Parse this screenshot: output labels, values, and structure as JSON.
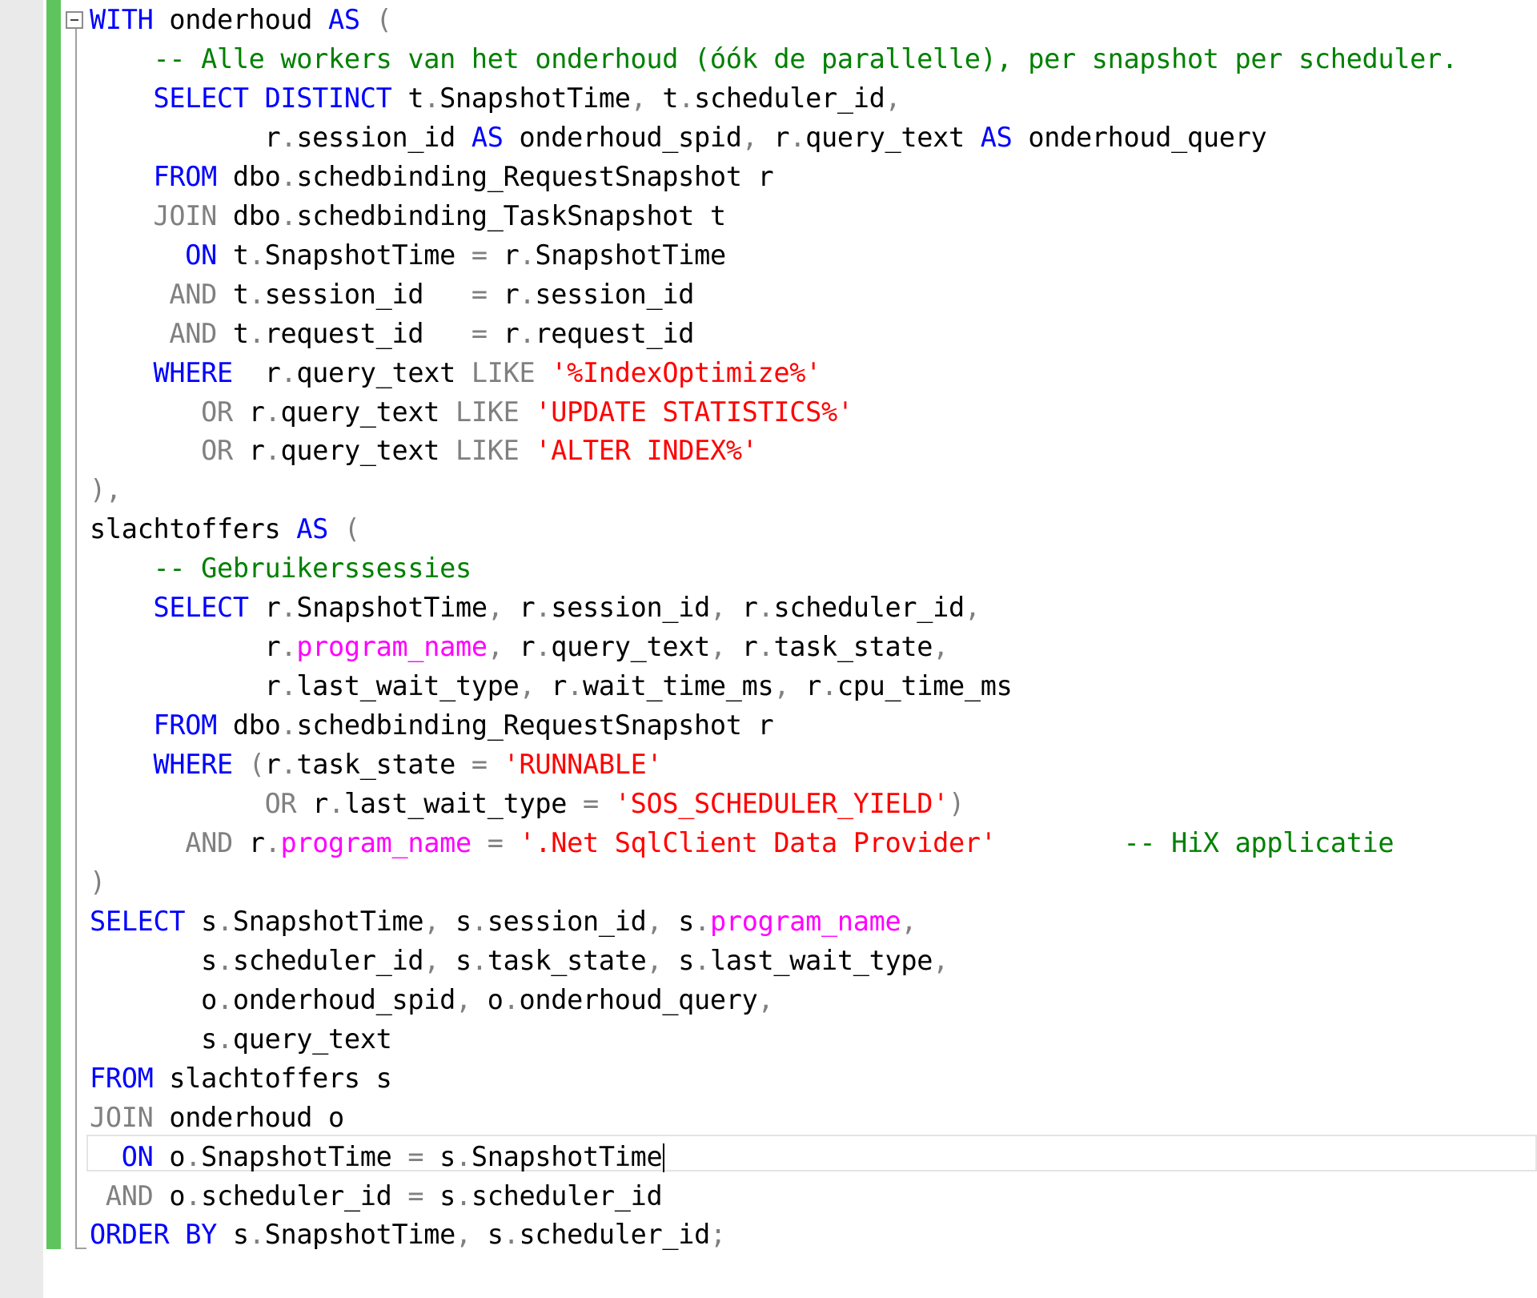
{
  "editor": {
    "colors": {
      "background": "#ffffff",
      "gutter": "#eaeaea",
      "change_bar": "#5ec55e",
      "keyword": "#0000ff",
      "operator": "#808080",
      "string": "#ff0000",
      "comment": "#008000",
      "function": "#ff00ff",
      "identifier": "#000000"
    },
    "fold_icon": "collapse-minus-icon",
    "caret_line": 29,
    "lines": [
      [
        {
          "t": "WITH",
          "k": "kw"
        },
        {
          "t": " onderhoud ",
          "k": "id"
        },
        {
          "t": "AS",
          "k": "kw"
        },
        {
          "t": " (",
          "k": "op"
        }
      ],
      [
        {
          "t": "    -- Alle workers van het onderhoud (óók de parallelle), per snapshot per scheduler.",
          "k": "cm"
        }
      ],
      [
        {
          "t": "    ",
          "k": "id"
        },
        {
          "t": "SELECT DISTINCT",
          "k": "kw"
        },
        {
          "t": " t",
          "k": "id"
        },
        {
          "t": ".",
          "k": "op"
        },
        {
          "t": "SnapshotTime",
          "k": "id"
        },
        {
          "t": ",",
          "k": "op"
        },
        {
          "t": " t",
          "k": "id"
        },
        {
          "t": ".",
          "k": "op"
        },
        {
          "t": "scheduler_id",
          "k": "id"
        },
        {
          "t": ",",
          "k": "op"
        }
      ],
      [
        {
          "t": "           r",
          "k": "id"
        },
        {
          "t": ".",
          "k": "op"
        },
        {
          "t": "session_id ",
          "k": "id"
        },
        {
          "t": "AS",
          "k": "kw"
        },
        {
          "t": " onderhoud_spid",
          "k": "id"
        },
        {
          "t": ",",
          "k": "op"
        },
        {
          "t": " r",
          "k": "id"
        },
        {
          "t": ".",
          "k": "op"
        },
        {
          "t": "query_text ",
          "k": "id"
        },
        {
          "t": "AS",
          "k": "kw"
        },
        {
          "t": " onderhoud_query",
          "k": "id"
        }
      ],
      [
        {
          "t": "    ",
          "k": "id"
        },
        {
          "t": "FROM",
          "k": "kw"
        },
        {
          "t": " dbo",
          "k": "id"
        },
        {
          "t": ".",
          "k": "op"
        },
        {
          "t": "schedbinding_RequestSnapshot r",
          "k": "id"
        }
      ],
      [
        {
          "t": "    ",
          "k": "id"
        },
        {
          "t": "JOIN",
          "k": "op"
        },
        {
          "t": " dbo",
          "k": "id"
        },
        {
          "t": ".",
          "k": "op"
        },
        {
          "t": "schedbinding_TaskSnapshot t",
          "k": "id"
        }
      ],
      [
        {
          "t": "      ",
          "k": "id"
        },
        {
          "t": "ON",
          "k": "kw"
        },
        {
          "t": " t",
          "k": "id"
        },
        {
          "t": ".",
          "k": "op"
        },
        {
          "t": "SnapshotTime ",
          "k": "id"
        },
        {
          "t": "=",
          "k": "op"
        },
        {
          "t": " r",
          "k": "id"
        },
        {
          "t": ".",
          "k": "op"
        },
        {
          "t": "SnapshotTime",
          "k": "id"
        }
      ],
      [
        {
          "t": "     ",
          "k": "id"
        },
        {
          "t": "AND",
          "k": "op"
        },
        {
          "t": " t",
          "k": "id"
        },
        {
          "t": ".",
          "k": "op"
        },
        {
          "t": "session_id   ",
          "k": "id"
        },
        {
          "t": "=",
          "k": "op"
        },
        {
          "t": " r",
          "k": "id"
        },
        {
          "t": ".",
          "k": "op"
        },
        {
          "t": "session_id",
          "k": "id"
        }
      ],
      [
        {
          "t": "     ",
          "k": "id"
        },
        {
          "t": "AND",
          "k": "op"
        },
        {
          "t": " t",
          "k": "id"
        },
        {
          "t": ".",
          "k": "op"
        },
        {
          "t": "request_id   ",
          "k": "id"
        },
        {
          "t": "=",
          "k": "op"
        },
        {
          "t": " r",
          "k": "id"
        },
        {
          "t": ".",
          "k": "op"
        },
        {
          "t": "request_id",
          "k": "id"
        }
      ],
      [
        {
          "t": "    ",
          "k": "id"
        },
        {
          "t": "WHERE",
          "k": "kw"
        },
        {
          "t": "  r",
          "k": "id"
        },
        {
          "t": ".",
          "k": "op"
        },
        {
          "t": "query_text ",
          "k": "id"
        },
        {
          "t": "LIKE",
          "k": "op"
        },
        {
          "t": " ",
          "k": "id"
        },
        {
          "t": "'%IndexOptimize%'",
          "k": "str"
        }
      ],
      [
        {
          "t": "       ",
          "k": "id"
        },
        {
          "t": "OR",
          "k": "op"
        },
        {
          "t": " r",
          "k": "id"
        },
        {
          "t": ".",
          "k": "op"
        },
        {
          "t": "query_text ",
          "k": "id"
        },
        {
          "t": "LIKE",
          "k": "op"
        },
        {
          "t": " ",
          "k": "id"
        },
        {
          "t": "'UPDATE STATISTICS%'",
          "k": "str"
        }
      ],
      [
        {
          "t": "       ",
          "k": "id"
        },
        {
          "t": "OR",
          "k": "op"
        },
        {
          "t": " r",
          "k": "id"
        },
        {
          "t": ".",
          "k": "op"
        },
        {
          "t": "query_text ",
          "k": "id"
        },
        {
          "t": "LIKE",
          "k": "op"
        },
        {
          "t": " ",
          "k": "id"
        },
        {
          "t": "'ALTER INDEX%'",
          "k": "str"
        }
      ],
      [
        {
          "t": "),",
          "k": "op"
        }
      ],
      [
        {
          "t": "slachtoffers ",
          "k": "id"
        },
        {
          "t": "AS",
          "k": "kw"
        },
        {
          "t": " (",
          "k": "op"
        }
      ],
      [
        {
          "t": "    -- Gebruikerssessies",
          "k": "cm"
        }
      ],
      [
        {
          "t": "    ",
          "k": "id"
        },
        {
          "t": "SELECT",
          "k": "kw"
        },
        {
          "t": " r",
          "k": "id"
        },
        {
          "t": ".",
          "k": "op"
        },
        {
          "t": "SnapshotTime",
          "k": "id"
        },
        {
          "t": ",",
          "k": "op"
        },
        {
          "t": " r",
          "k": "id"
        },
        {
          "t": ".",
          "k": "op"
        },
        {
          "t": "session_id",
          "k": "id"
        },
        {
          "t": ",",
          "k": "op"
        },
        {
          "t": " r",
          "k": "id"
        },
        {
          "t": ".",
          "k": "op"
        },
        {
          "t": "scheduler_id",
          "k": "id"
        },
        {
          "t": ",",
          "k": "op"
        }
      ],
      [
        {
          "t": "           r",
          "k": "id"
        },
        {
          "t": ".",
          "k": "op"
        },
        {
          "t": "program_name",
          "k": "fn"
        },
        {
          "t": ",",
          "k": "op"
        },
        {
          "t": " r",
          "k": "id"
        },
        {
          "t": ".",
          "k": "op"
        },
        {
          "t": "query_text",
          "k": "id"
        },
        {
          "t": ",",
          "k": "op"
        },
        {
          "t": " r",
          "k": "id"
        },
        {
          "t": ".",
          "k": "op"
        },
        {
          "t": "task_state",
          "k": "id"
        },
        {
          "t": ",",
          "k": "op"
        }
      ],
      [
        {
          "t": "           r",
          "k": "id"
        },
        {
          "t": ".",
          "k": "op"
        },
        {
          "t": "last_wait_type",
          "k": "id"
        },
        {
          "t": ",",
          "k": "op"
        },
        {
          "t": " r",
          "k": "id"
        },
        {
          "t": ".",
          "k": "op"
        },
        {
          "t": "wait_time_ms",
          "k": "id"
        },
        {
          "t": ",",
          "k": "op"
        },
        {
          "t": " r",
          "k": "id"
        },
        {
          "t": ".",
          "k": "op"
        },
        {
          "t": "cpu_time_ms",
          "k": "id"
        }
      ],
      [
        {
          "t": "    ",
          "k": "id"
        },
        {
          "t": "FROM",
          "k": "kw"
        },
        {
          "t": " dbo",
          "k": "id"
        },
        {
          "t": ".",
          "k": "op"
        },
        {
          "t": "schedbinding_RequestSnapshot r",
          "k": "id"
        }
      ],
      [
        {
          "t": "    ",
          "k": "id"
        },
        {
          "t": "WHERE",
          "k": "kw"
        },
        {
          "t": " (",
          "k": "op"
        },
        {
          "t": "r",
          "k": "id"
        },
        {
          "t": ".",
          "k": "op"
        },
        {
          "t": "task_state ",
          "k": "id"
        },
        {
          "t": "=",
          "k": "op"
        },
        {
          "t": " ",
          "k": "id"
        },
        {
          "t": "'RUNNABLE'",
          "k": "str"
        }
      ],
      [
        {
          "t": "           ",
          "k": "id"
        },
        {
          "t": "OR",
          "k": "op"
        },
        {
          "t": " r",
          "k": "id"
        },
        {
          "t": ".",
          "k": "op"
        },
        {
          "t": "last_wait_type ",
          "k": "id"
        },
        {
          "t": "=",
          "k": "op"
        },
        {
          "t": " ",
          "k": "id"
        },
        {
          "t": "'SOS_SCHEDULER_YIELD'",
          "k": "str"
        },
        {
          "t": ")",
          "k": "op"
        }
      ],
      [
        {
          "t": "      ",
          "k": "id"
        },
        {
          "t": "AND",
          "k": "op"
        },
        {
          "t": " r",
          "k": "id"
        },
        {
          "t": ".",
          "k": "op"
        },
        {
          "t": "program_name",
          "k": "fn"
        },
        {
          "t": " ",
          "k": "id"
        },
        {
          "t": "=",
          "k": "op"
        },
        {
          "t": " ",
          "k": "id"
        },
        {
          "t": "'.Net SqlClient Data Provider'",
          "k": "str"
        },
        {
          "t": "        -- HiX applicatie",
          "k": "cm"
        }
      ],
      [
        {
          "t": ")",
          "k": "op"
        }
      ],
      [
        {
          "t": "SELECT",
          "k": "kw"
        },
        {
          "t": " s",
          "k": "id"
        },
        {
          "t": ".",
          "k": "op"
        },
        {
          "t": "SnapshotTime",
          "k": "id"
        },
        {
          "t": ",",
          "k": "op"
        },
        {
          "t": " s",
          "k": "id"
        },
        {
          "t": ".",
          "k": "op"
        },
        {
          "t": "session_id",
          "k": "id"
        },
        {
          "t": ",",
          "k": "op"
        },
        {
          "t": " s",
          "k": "id"
        },
        {
          "t": ".",
          "k": "op"
        },
        {
          "t": "program_name",
          "k": "fn"
        },
        {
          "t": ",",
          "k": "op"
        }
      ],
      [
        {
          "t": "       s",
          "k": "id"
        },
        {
          "t": ".",
          "k": "op"
        },
        {
          "t": "scheduler_id",
          "k": "id"
        },
        {
          "t": ",",
          "k": "op"
        },
        {
          "t": " s",
          "k": "id"
        },
        {
          "t": ".",
          "k": "op"
        },
        {
          "t": "task_state",
          "k": "id"
        },
        {
          "t": ",",
          "k": "op"
        },
        {
          "t": " s",
          "k": "id"
        },
        {
          "t": ".",
          "k": "op"
        },
        {
          "t": "last_wait_type",
          "k": "id"
        },
        {
          "t": ",",
          "k": "op"
        }
      ],
      [
        {
          "t": "       o",
          "k": "id"
        },
        {
          "t": ".",
          "k": "op"
        },
        {
          "t": "onderhoud_spid",
          "k": "id"
        },
        {
          "t": ",",
          "k": "op"
        },
        {
          "t": " o",
          "k": "id"
        },
        {
          "t": ".",
          "k": "op"
        },
        {
          "t": "onderhoud_query",
          "k": "id"
        },
        {
          "t": ",",
          "k": "op"
        }
      ],
      [
        {
          "t": "       s",
          "k": "id"
        },
        {
          "t": ".",
          "k": "op"
        },
        {
          "t": "query_text",
          "k": "id"
        }
      ],
      [
        {
          "t": "FROM",
          "k": "kw"
        },
        {
          "t": " slachtoffers s",
          "k": "id"
        }
      ],
      [
        {
          "t": "JOIN",
          "k": "op"
        },
        {
          "t": " onderhoud o",
          "k": "id"
        }
      ],
      [
        {
          "t": "  ",
          "k": "id"
        },
        {
          "t": "ON",
          "k": "kw"
        },
        {
          "t": " o",
          "k": "id"
        },
        {
          "t": ".",
          "k": "op"
        },
        {
          "t": "SnapshotTime ",
          "k": "id"
        },
        {
          "t": "=",
          "k": "op"
        },
        {
          "t": " s",
          "k": "id"
        },
        {
          "t": ".",
          "k": "op"
        },
        {
          "t": "SnapshotTime",
          "k": "id"
        }
      ],
      [
        {
          "t": " ",
          "k": "id"
        },
        {
          "t": "AND",
          "k": "op"
        },
        {
          "t": " o",
          "k": "id"
        },
        {
          "t": ".",
          "k": "op"
        },
        {
          "t": "scheduler_id ",
          "k": "id"
        },
        {
          "t": "=",
          "k": "op"
        },
        {
          "t": " s",
          "k": "id"
        },
        {
          "t": ".",
          "k": "op"
        },
        {
          "t": "scheduler_id",
          "k": "id"
        }
      ],
      [
        {
          "t": "ORDER BY",
          "k": "kw"
        },
        {
          "t": " s",
          "k": "id"
        },
        {
          "t": ".",
          "k": "op"
        },
        {
          "t": "SnapshotTime",
          "k": "id"
        },
        {
          "t": ",",
          "k": "op"
        },
        {
          "t": " s",
          "k": "id"
        },
        {
          "t": ".",
          "k": "op"
        },
        {
          "t": "scheduler_id",
          "k": "id"
        },
        {
          "t": ";",
          "k": "op"
        }
      ]
    ]
  }
}
